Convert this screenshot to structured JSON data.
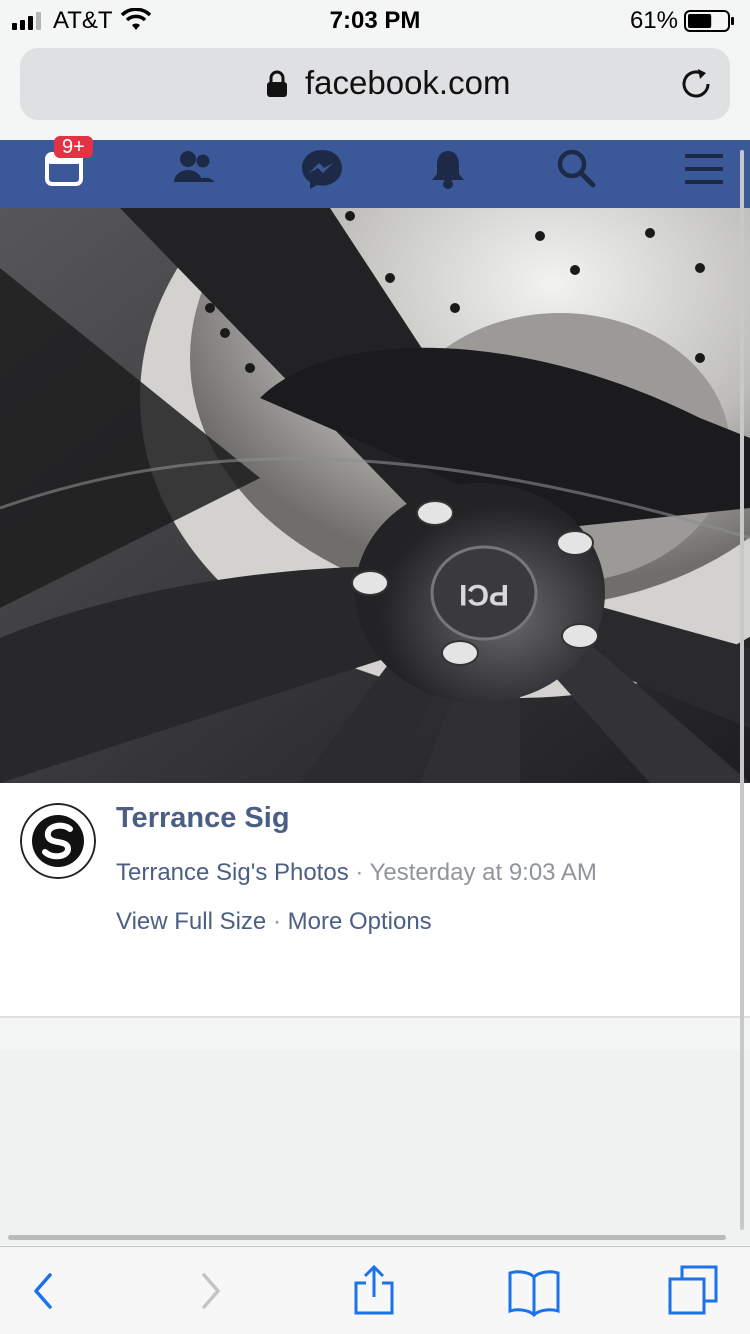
{
  "status_bar": {
    "carrier": "AT&T",
    "time": "7:03 PM",
    "battery_percent": "61%",
    "battery_level": 0.61
  },
  "browser": {
    "url": "facebook.com"
  },
  "fb_nav": {
    "items": [
      {
        "icon": "news-feed-icon"
      },
      {
        "icon": "friend-requests-icon"
      },
      {
        "icon": "messenger-icon"
      },
      {
        "icon": "notifications-icon"
      },
      {
        "icon": "search-icon"
      },
      {
        "icon": "menu-icon"
      }
    ],
    "badge": "9+",
    "colors": {
      "nav_bg": "#3b5998",
      "badge": "#e33244",
      "icons": "#1d2a47"
    }
  },
  "photo": {
    "subject": "wheel-photo"
  },
  "post": {
    "author": "Terrance Sig",
    "album": "Terrance Sig's Photos",
    "separator": " · ",
    "timestamp": "Yesterday at 9:03 AM",
    "action_view_full": "View Full Size",
    "action_more": "More Options",
    "colors": {
      "link": "#4b5f85",
      "meta": "#90949c"
    }
  },
  "toolbar": {
    "items": [
      {
        "icon": "back-icon"
      },
      {
        "icon": "forward-icon"
      },
      {
        "icon": "share-icon"
      },
      {
        "icon": "bookmarks-icon"
      },
      {
        "icon": "tabs-icon"
      }
    ],
    "colors": {
      "active": "#1a73e8",
      "disabled": "#c4c4c6"
    }
  }
}
